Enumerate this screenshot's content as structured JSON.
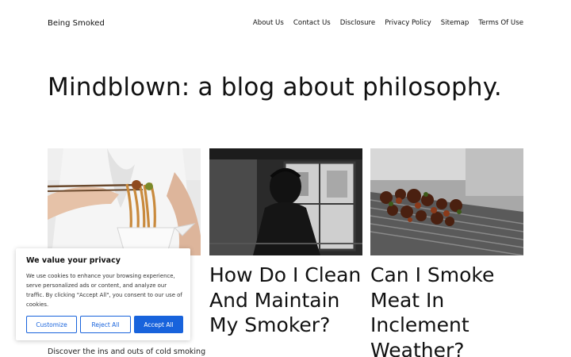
{
  "header": {
    "site_title": "Being Smoked",
    "nav": [
      "About Us",
      "Contact Us",
      "Disclosure",
      "Privacy Policy",
      "Sitemap",
      "Terms Of Use"
    ]
  },
  "page": {
    "title": "Mindblown: a blog about philosophy."
  },
  "posts": [
    {
      "title": "",
      "excerpt": "Discover the ins and outs of cold smoking"
    },
    {
      "title": "How Do I Clean And Maintain My Smoker?"
    },
    {
      "title": "Can I Smoke Meat In Inclement Weather?"
    }
  ],
  "cookie_banner": {
    "title": "We value your privacy",
    "text": "We use cookies to enhance your browsing experience, serve personalized ads or content, and analyze our traffic. By clicking \"Accept All\", you consent to our use of cookies.",
    "customize": "Customize",
    "reject": "Reject All",
    "accept": "Accept All"
  },
  "colors": {
    "accent": "#1863dc"
  }
}
